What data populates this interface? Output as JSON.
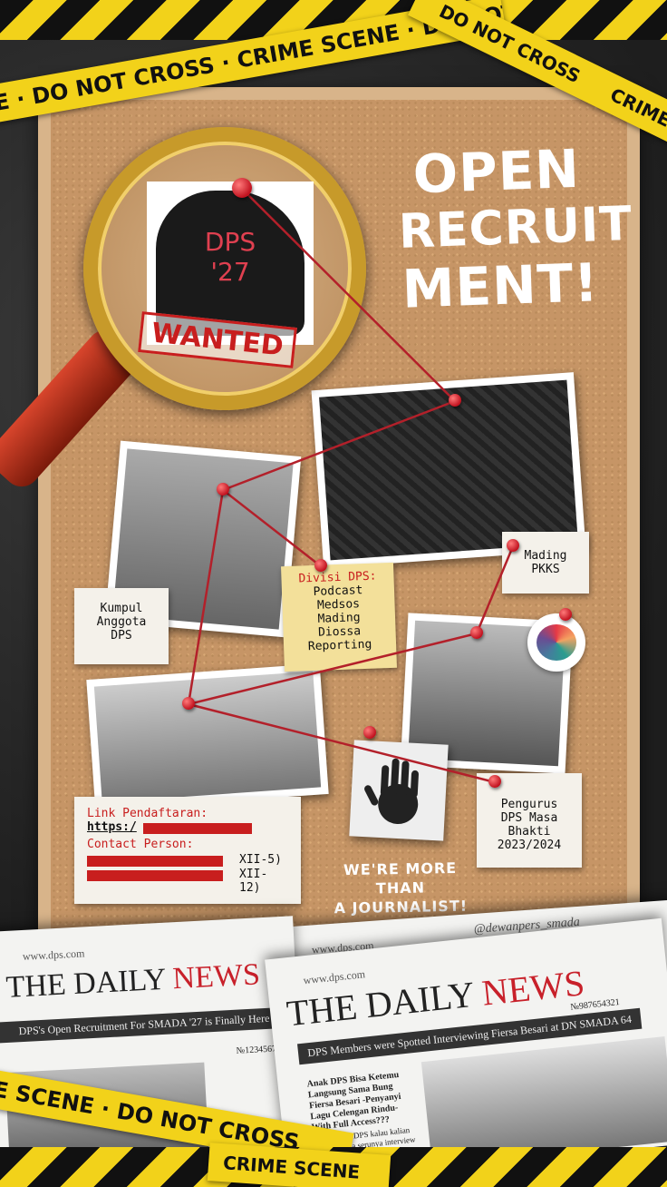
{
  "tape": {
    "text_top": "NE · DO NOT CROSS · CRIME SCENE · DO NOT",
    "text_top_right_1": "DO NOT CROSS",
    "text_top_right_2": "CRIME SCENE",
    "text_bottom": "E SCENE · DO NOT CROSS",
    "text_bottom_2": "CRIME SCENE"
  },
  "poster": {
    "headline": [
      "OPEN",
      "RECRUIT",
      "MENT!"
    ],
    "wanted_badge": "WANTED",
    "silhouette_text": [
      "DPS",
      "'27"
    ],
    "tagline": [
      "WE'RE MORE THAN",
      "A JOURNALIST!"
    ]
  },
  "notes": {
    "kumpul": [
      "Kumpul",
      "Anggota",
      "DPS"
    ],
    "divisi": [
      "Divisi DPS:",
      "Podcast",
      "Medsos",
      "Mading",
      "Diossa",
      "Reporting"
    ],
    "mading": [
      "Mading",
      "PKKS"
    ],
    "pengurus": [
      "Pengurus",
      "DPS Masa",
      "Bhakti",
      "2023/2024"
    ],
    "link_label": "Link Pendaftaran:",
    "link_value": "https:/",
    "contact_label": "Contact Person:",
    "contact_1": "XII-5)",
    "contact_2": "XII-12)"
  },
  "newspaper_left": {
    "url": "www.dps.com",
    "title_black": "THE DAILY",
    "title_red": "NEWS",
    "headline": "DPS's Open Recruitment For SMADA '27 is Finally Here",
    "number": "№123456789"
  },
  "newspaper_right": {
    "url": "www.dps.com",
    "url_back": "www.dps.com",
    "handle": "@dewanpers_smada",
    "title_black": "THE DAILY",
    "title_red": "NEWS",
    "number": "№987654321",
    "headline": "DPS Members were Spotted Interviewing Fiersa Besari at DN SMADA 64",
    "article_headline": "Anak DPS Bisa Ketemu Langsung Sama Bung Fiersa Besari -Penyanyi Lagu Celengan Rindu- With Full Access???",
    "article_body": "Buruan join DPS kalau kalian kepo gimana serunya interview artis"
  },
  "colors": {
    "tape_yellow": "#f2d21a",
    "pin_red": "#c1121f",
    "news_red": "#c8202a",
    "cork": "#c69566"
  }
}
